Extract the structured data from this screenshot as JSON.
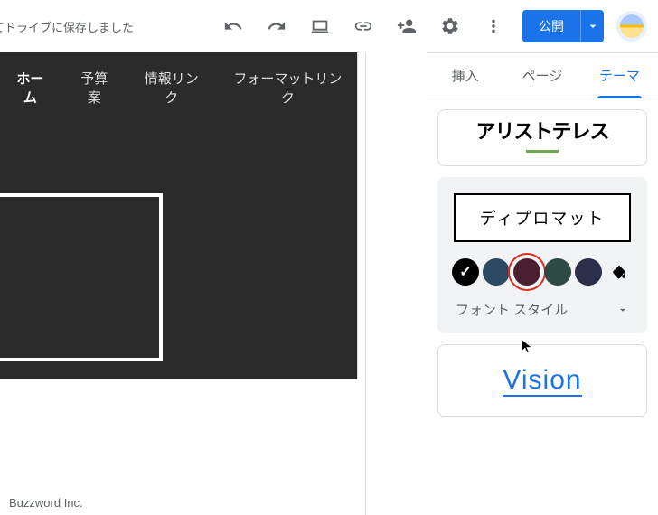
{
  "toolbar": {
    "save_status": "てドライブに保存しました",
    "publish_label": "公開"
  },
  "site": {
    "nav": [
      "ホーム",
      "予算案",
      "情報リンク",
      "フォーマットリンク"
    ],
    "hero_text": "",
    "footer": "Buzzword Inc."
  },
  "panel": {
    "tabs": [
      "挿入",
      "ページ",
      "テーマ"
    ],
    "active_tab": 2,
    "font_style_label": "フォント スタイル"
  },
  "themes": {
    "aristoteles": "アリストテレス",
    "diplomat": "ディプロマット",
    "vision": "Vision"
  },
  "colors": [
    {
      "hex": "#000000",
      "checked": true
    },
    {
      "hex": "#2d4a63",
      "checked": false
    },
    {
      "hex": "#4a1f2f",
      "checked": false,
      "selected": true
    },
    {
      "hex": "#2d4a44",
      "checked": false
    },
    {
      "hex": "#2d2f4a",
      "checked": false
    }
  ]
}
